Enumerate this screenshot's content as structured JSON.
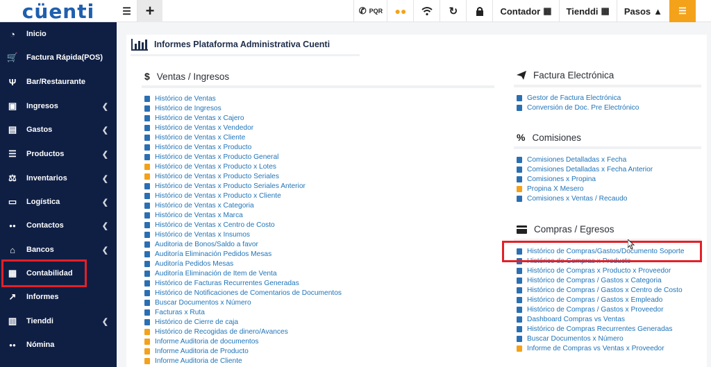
{
  "app": {
    "logo": "cüenti"
  },
  "topbar": {
    "menu_icon": "hamburger-icon",
    "plus_label": "+",
    "pqr_label": "PQR",
    "contador_label": "Contador",
    "tienddi_label": "Tienddi",
    "pasos_label": "Pasos"
  },
  "sidebar": {
    "items": [
      {
        "label": "Inicio",
        "icon": "dashboard-icon",
        "chevron": false
      },
      {
        "label": "Factura Rápida(POS)",
        "icon": "cart-icon",
        "chevron": false
      },
      {
        "label": "Bar/Restaurante",
        "icon": "utensils-icon",
        "chevron": false
      },
      {
        "label": "Ingresos",
        "icon": "money-icon",
        "chevron": true
      },
      {
        "label": "Gastos",
        "icon": "shopping-bag-icon",
        "chevron": true
      },
      {
        "label": "Productos",
        "icon": "list-icon",
        "chevron": true
      },
      {
        "label": "Inventarios",
        "icon": "balance-icon",
        "chevron": true
      },
      {
        "label": "Logística",
        "icon": "bus-icon",
        "chevron": true
      },
      {
        "label": "Contactos",
        "icon": "users-icon",
        "chevron": true
      },
      {
        "label": "Bancos",
        "icon": "bank-icon",
        "chevron": true
      },
      {
        "label": "Contabilidad",
        "icon": "calculator-icon",
        "chevron": false
      },
      {
        "label": "Informes",
        "icon": "chart-line-icon",
        "chevron": false
      },
      {
        "label": "Tienddi",
        "icon": "basket-icon",
        "chevron": true
      },
      {
        "label": "Nómina",
        "icon": "users-icon",
        "chevron": false
      }
    ]
  },
  "page": {
    "title": "Informes Plataforma Administrativa Cuenti",
    "title_icon": "bar-chart-icon"
  },
  "ventas": {
    "title": "Ventas / Ingresos",
    "icon": "dollar-icon",
    "items": [
      {
        "label": "Histórico de Ventas",
        "icon": "doc"
      },
      {
        "label": "Histórico de Ingresos",
        "icon": "doc"
      },
      {
        "label": "Histórico de Ventas x Cajero",
        "icon": "doc"
      },
      {
        "label": "Histórico de Ventas x Vendedor",
        "icon": "doc"
      },
      {
        "label": "Histórico de Ventas x Cliente",
        "icon": "doc"
      },
      {
        "label": "Histórico de Ventas x Producto",
        "icon": "doc"
      },
      {
        "label": "Histórico de Ventas x Producto General",
        "icon": "doc"
      },
      {
        "label": "Histórico de Ventas x Producto x Lotes",
        "icon": "star"
      },
      {
        "label": "Histórico de Ventas x Producto Seriales",
        "icon": "star"
      },
      {
        "label": "Histórico de Ventas x Producto Seriales Anterior",
        "icon": "doc"
      },
      {
        "label": "Histórico de Ventas x Producto x Cliente",
        "icon": "doc"
      },
      {
        "label": "Histórico de Ventas x Categoria",
        "icon": "doc"
      },
      {
        "label": "Histórico de Ventas x Marca",
        "icon": "doc"
      },
      {
        "label": "Histórico de Ventas x Centro de Costo",
        "icon": "doc"
      },
      {
        "label": "Histórico de Ventas x Insumos",
        "icon": "doc"
      },
      {
        "label": "Auditoria de Bonos/Saldo a favor",
        "icon": "doc"
      },
      {
        "label": "Auditoría Eliminación Pedidos Mesas",
        "icon": "doc"
      },
      {
        "label": "Auditoría Pedidos Mesas",
        "icon": "doc"
      },
      {
        "label": "Auditoría Eliminación de Item de Venta",
        "icon": "doc"
      },
      {
        "label": "Histórico de Facturas Recurrentes Generadas",
        "icon": "doc"
      },
      {
        "label": "Histórico de Notificaciones de Comentarios de Documentos",
        "icon": "doc"
      },
      {
        "label": "Buscar Documentos x Número",
        "icon": "doc"
      },
      {
        "label": "Facturas x Ruta",
        "icon": "doc"
      },
      {
        "label": "Histórico de Cierre de caja",
        "icon": "doc"
      },
      {
        "label": "Histórico de Recogidas de dinero/Avances",
        "icon": "star"
      },
      {
        "label": "Informe Auditoria de documentos",
        "icon": "star"
      },
      {
        "label": "Informe Auditoria de Producto",
        "icon": "star"
      },
      {
        "label": "Informe Auditoria de Cliente",
        "icon": "star"
      }
    ]
  },
  "factura": {
    "title": "Factura Electrónica",
    "icon": "paper-plane-icon",
    "items": [
      {
        "label": "Gestor de Factura Electrónica",
        "icon": "doc"
      },
      {
        "label": "Conversión de Doc. Pre Electrónico",
        "icon": "doc"
      }
    ]
  },
  "comisiones": {
    "title": "Comisiones",
    "icon": "percent-icon",
    "items": [
      {
        "label": "Comisiones Detalladas x Fecha",
        "icon": "doc"
      },
      {
        "label": "Comisiones Detalladas x Fecha Anterior",
        "icon": "doc"
      },
      {
        "label": "Comisiones x Propina",
        "icon": "doc"
      },
      {
        "label": "Propina X Mesero",
        "icon": "star"
      },
      {
        "label": "Comisiones x Ventas / Recaudo",
        "icon": "doc"
      }
    ]
  },
  "compras": {
    "title": "Compras / Egresos",
    "icon": "credit-card-icon",
    "items": [
      {
        "label": "Histórico de Compras/Gastos/Documento Soporte",
        "icon": "doc"
      },
      {
        "label": "Histórico de Compras x Producto",
        "icon": "doc"
      },
      {
        "label": "Histórico de Compras x Producto x Proveedor",
        "icon": "doc"
      },
      {
        "label": "Histórico de Compras / Gastos x Categoria",
        "icon": "doc"
      },
      {
        "label": "Histórico de Compras / Gastos x Centro de Costo",
        "icon": "doc"
      },
      {
        "label": "Histórico de Compras / Gastos x Empleado",
        "icon": "doc"
      },
      {
        "label": "Histórico de Compras / Gastos x Proveedor",
        "icon": "doc"
      },
      {
        "label": "Dashboard Compras vs Ventas",
        "icon": "doc"
      },
      {
        "label": "Histórico de Compras Recurrentes Generadas",
        "icon": "doc"
      },
      {
        "label": "Buscar Documentos x Número",
        "icon": "doc"
      },
      {
        "label": "Informe de Compras vs Ventas x Proveedor",
        "icon": "star"
      }
    ]
  },
  "colors": {
    "sidebar_bg": "#0f1f44",
    "link": "#1f74b8",
    "accent": "#f3a21a",
    "highlight": "#e32028"
  }
}
